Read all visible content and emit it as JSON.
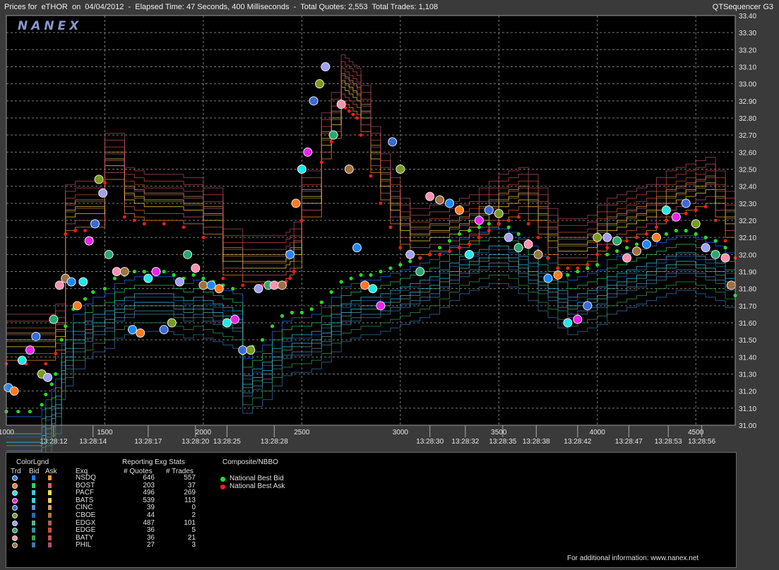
{
  "header": {
    "title": "Prices for  eTHOR  on  04/04/2012  -  Elapsed Time: 47 Seconds, 400 Milliseconds  -  Total Quotes: 2,553  Total Trades: 1,108",
    "brand": "QTSequencer G3",
    "watermark": "NANEX"
  },
  "colors": {
    "background": "#000000",
    "national_best_bid": "#22dd22",
    "national_best_ask": "#ff1a1a"
  },
  "chart_data": {
    "type": "line",
    "title": "",
    "xlabel": "",
    "ylabel": "",
    "grid": true,
    "ylim": [
      31.0,
      33.4
    ],
    "xlim": [
      1000,
      4700
    ],
    "y_ticks": [
      "31.00",
      "31.10",
      "31.20",
      "31.30",
      "31.40",
      "31.50",
      "31.60",
      "31.70",
      "31.80",
      "31.90",
      "32.00",
      "32.10",
      "32.20",
      "32.30",
      "32.40",
      "32.50",
      "32.60",
      "32.70",
      "32.80",
      "32.90",
      "33.00",
      "33.10",
      "33.20",
      "33.30",
      "33.40"
    ],
    "x_sequence_ticks": [
      {
        "value": 1000,
        "label": "1000"
      },
      {
        "value": 1500,
        "label": "1500"
      },
      {
        "value": 2000,
        "label": "2000"
      },
      {
        "value": 2500,
        "label": "2500"
      },
      {
        "value": 3000,
        "label": "3000"
      },
      {
        "value": 3500,
        "label": "3500"
      },
      {
        "value": 4000,
        "label": "4000"
      },
      {
        "value": 4500,
        "label": "4500"
      }
    ],
    "x_time_ticks": [
      {
        "value": 1240,
        "label": "13:28:12"
      },
      {
        "value": 1440,
        "label": "13:28:14"
      },
      {
        "value": 1720,
        "label": "13:28:17"
      },
      {
        "value": 1960,
        "label": "13:28:20"
      },
      {
        "value": 2120,
        "label": "13:28:25"
      },
      {
        "value": 2360,
        "label": "13:28:28"
      },
      {
        "value": 3150,
        "label": "13:28:30"
      },
      {
        "value": 3330,
        "label": "13:28:32"
      },
      {
        "value": 3520,
        "label": "13:28:35"
      },
      {
        "value": 3690,
        "label": "13:28:38"
      },
      {
        "value": 3900,
        "label": "13:28:42"
      },
      {
        "value": 4160,
        "label": "13:28:47"
      },
      {
        "value": 4360,
        "label": "13:28:53"
      },
      {
        "value": 4530,
        "label": "13:28:56"
      }
    ],
    "series": [
      {
        "name": "National Best Bid",
        "role": "nbbo_bid",
        "x": [
          1000,
          1060,
          1120,
          1180,
          1200,
          1230,
          1250,
          1280,
          1300,
          1340,
          1400,
          1440,
          1500,
          1550,
          1600,
          1650,
          1700,
          1750,
          1800,
          1850,
          1900,
          1950,
          2000,
          2050,
          2100,
          2150,
          2200,
          2250,
          2300,
          2350,
          2400,
          2450,
          2500,
          2550,
          2600,
          2650,
          2700,
          2750,
          2800,
          2850,
          2900,
          2950,
          3000,
          3050,
          3100,
          3150,
          3200,
          3250,
          3300,
          3350,
          3400,
          3450,
          3500,
          3550,
          3600,
          3650,
          3700,
          3750,
          3800,
          3850,
          3900,
          3950,
          4000,
          4050,
          4100,
          4150,
          4200,
          4250,
          4300,
          4350,
          4400,
          4450,
          4500,
          4550,
          4600,
          4650,
          4700
        ],
        "y": [
          31.08,
          31.08,
          31.08,
          31.12,
          31.18,
          31.24,
          31.3,
          31.5,
          31.58,
          31.68,
          31.74,
          31.78,
          31.8,
          31.86,
          31.88,
          31.9,
          31.9,
          31.9,
          31.9,
          31.88,
          31.86,
          31.88,
          31.86,
          31.84,
          31.82,
          31.8,
          31.42,
          31.46,
          31.5,
          31.58,
          31.64,
          31.66,
          31.66,
          31.68,
          31.72,
          31.78,
          31.84,
          31.86,
          31.88,
          31.88,
          31.9,
          31.92,
          31.94,
          31.96,
          31.98,
          32.0,
          32.04,
          32.08,
          32.12,
          32.14,
          32.16,
          32.18,
          32.18,
          32.16,
          32.12,
          32.08,
          32.02,
          31.98,
          31.92,
          31.88,
          31.9,
          31.92,
          31.94,
          32.0,
          32.02,
          32.04,
          32.06,
          32.08,
          32.1,
          32.12,
          32.14,
          32.14,
          32.12,
          32.1,
          32.08,
          32.04,
          31.76
        ]
      },
      {
        "name": "National Best Ask",
        "role": "nbbo_ask",
        "x": [
          1000,
          1100,
          1200,
          1250,
          1300,
          1350,
          1400,
          1500,
          1600,
          1650,
          1700,
          1800,
          1900,
          2000,
          2100,
          2200,
          2300,
          2400,
          2420,
          2440,
          2460,
          2500,
          2600,
          2650,
          2700,
          2720,
          2740,
          2760,
          2780,
          2800,
          2850,
          2900,
          2950,
          3000,
          3050,
          3100,
          3150,
          3200,
          3250,
          3300,
          3350,
          3400,
          3450,
          3500,
          3550,
          3600,
          3650,
          3700,
          3750,
          3800,
          3850,
          3900,
          3950,
          4000,
          4050,
          4100,
          4150,
          4200,
          4250,
          4300,
          4350,
          4400,
          4450,
          4500,
          4550,
          4600,
          4650,
          4700
        ],
        "y": [
          31.36,
          31.36,
          31.36,
          31.42,
          32.12,
          32.14,
          32.14,
          32.42,
          32.22,
          32.2,
          32.18,
          32.18,
          32.16,
          32.1,
          31.86,
          31.82,
          31.82,
          31.82,
          31.84,
          31.86,
          31.9,
          32.2,
          32.54,
          32.66,
          32.88,
          32.86,
          32.84,
          32.82,
          32.8,
          32.7,
          32.46,
          32.3,
          32.16,
          32.04,
          31.98,
          31.98,
          32.0,
          32.0,
          32.02,
          32.04,
          32.06,
          32.1,
          32.14,
          32.18,
          32.2,
          32.22,
          32.18,
          32.1,
          31.98,
          31.92,
          31.92,
          31.92,
          31.94,
          32.0,
          32.04,
          32.06,
          32.08,
          32.1,
          32.12,
          32.16,
          32.2,
          32.22,
          32.24,
          32.26,
          32.28,
          32.2,
          32.08,
          31.98
        ]
      }
    ],
    "trades_sample": [
      {
        "x": 1010,
        "y": 31.22
      },
      {
        "x": 1040,
        "y": 31.2
      },
      {
        "x": 1080,
        "y": 31.38
      },
      {
        "x": 1120,
        "y": 31.44
      },
      {
        "x": 1150,
        "y": 31.52
      },
      {
        "x": 1180,
        "y": 31.3
      },
      {
        "x": 1210,
        "y": 31.28
      },
      {
        "x": 1240,
        "y": 31.62
      },
      {
        "x": 1270,
        "y": 31.82
      },
      {
        "x": 1300,
        "y": 31.86
      },
      {
        "x": 1330,
        "y": 31.84
      },
      {
        "x": 1360,
        "y": 31.7
      },
      {
        "x": 1390,
        "y": 31.84
      },
      {
        "x": 1420,
        "y": 32.08
      },
      {
        "x": 1450,
        "y": 32.18
      },
      {
        "x": 1470,
        "y": 32.44
      },
      {
        "x": 1490,
        "y": 32.36
      },
      {
        "x": 1520,
        "y": 32.0
      },
      {
        "x": 1560,
        "y": 31.9
      },
      {
        "x": 1600,
        "y": 31.9
      },
      {
        "x": 1640,
        "y": 31.56
      },
      {
        "x": 1680,
        "y": 31.54
      },
      {
        "x": 1720,
        "y": 31.86
      },
      {
        "x": 1760,
        "y": 31.9
      },
      {
        "x": 1800,
        "y": 31.56
      },
      {
        "x": 1840,
        "y": 31.6
      },
      {
        "x": 1880,
        "y": 31.84
      },
      {
        "x": 1920,
        "y": 32.0
      },
      {
        "x": 1960,
        "y": 31.92
      },
      {
        "x": 2000,
        "y": 31.82
      },
      {
        "x": 2040,
        "y": 31.82
      },
      {
        "x": 2080,
        "y": 31.8
      },
      {
        "x": 2120,
        "y": 31.6
      },
      {
        "x": 2160,
        "y": 31.62
      },
      {
        "x": 2200,
        "y": 31.44
      },
      {
        "x": 2240,
        "y": 31.44
      },
      {
        "x": 2280,
        "y": 31.8
      },
      {
        "x": 2330,
        "y": 31.82
      },
      {
        "x": 2360,
        "y": 31.82
      },
      {
        "x": 2400,
        "y": 31.82
      },
      {
        "x": 2440,
        "y": 32.0
      },
      {
        "x": 2470,
        "y": 32.3
      },
      {
        "x": 2500,
        "y": 32.5
      },
      {
        "x": 2530,
        "y": 32.6
      },
      {
        "x": 2560,
        "y": 32.9
      },
      {
        "x": 2590,
        "y": 33.0
      },
      {
        "x": 2620,
        "y": 33.1
      },
      {
        "x": 2660,
        "y": 32.7
      },
      {
        "x": 2700,
        "y": 32.88
      },
      {
        "x": 2740,
        "y": 32.5
      },
      {
        "x": 2780,
        "y": 32.04
      },
      {
        "x": 2820,
        "y": 31.82
      },
      {
        "x": 2860,
        "y": 31.8
      },
      {
        "x": 2900,
        "y": 31.7
      },
      {
        "x": 2960,
        "y": 32.66
      },
      {
        "x": 3000,
        "y": 32.5
      },
      {
        "x": 3050,
        "y": 32.0
      },
      {
        "x": 3100,
        "y": 31.9
      },
      {
        "x": 3150,
        "y": 32.34
      },
      {
        "x": 3200,
        "y": 32.32
      },
      {
        "x": 3250,
        "y": 32.3
      },
      {
        "x": 3300,
        "y": 32.26
      },
      {
        "x": 3350,
        "y": 32.0
      },
      {
        "x": 3400,
        "y": 32.2
      },
      {
        "x": 3450,
        "y": 32.26
      },
      {
        "x": 3500,
        "y": 32.24
      },
      {
        "x": 3550,
        "y": 32.1
      },
      {
        "x": 3600,
        "y": 32.04
      },
      {
        "x": 3650,
        "y": 32.06
      },
      {
        "x": 3700,
        "y": 32.0
      },
      {
        "x": 3750,
        "y": 31.86
      },
      {
        "x": 3800,
        "y": 31.88
      },
      {
        "x": 3850,
        "y": 31.6
      },
      {
        "x": 3900,
        "y": 31.62
      },
      {
        "x": 3950,
        "y": 31.7
      },
      {
        "x": 4000,
        "y": 32.1
      },
      {
        "x": 4050,
        "y": 32.1
      },
      {
        "x": 4100,
        "y": 32.08
      },
      {
        "x": 4150,
        "y": 31.98
      },
      {
        "x": 4200,
        "y": 32.02
      },
      {
        "x": 4250,
        "y": 32.06
      },
      {
        "x": 4300,
        "y": 32.1
      },
      {
        "x": 4350,
        "y": 32.26
      },
      {
        "x": 4400,
        "y": 32.22
      },
      {
        "x": 4450,
        "y": 32.3
      },
      {
        "x": 4500,
        "y": 32.18
      },
      {
        "x": 4550,
        "y": 32.04
      },
      {
        "x": 4600,
        "y": 32.0
      },
      {
        "x": 4650,
        "y": 31.98
      },
      {
        "x": 4680,
        "y": 31.82
      }
    ]
  },
  "legend": {
    "color_legend_title": "ColorLgnd",
    "col_trd": "Trd",
    "col_bid": "Bid",
    "col_ask": "Ask",
    "col_exq": "Exq",
    "stats_title": "Reporting Exg Stats",
    "col_quotes": "# Quotes",
    "col_trades": "# Trades",
    "nbbo_title": "Composite/NBBO",
    "nbbo_bid_label": "National Best Bid",
    "nbbo_ask_label": "National Best Ask",
    "footer": "For additional information: www.nanex.net",
    "exchanges": [
      {
        "code": "NSDQ",
        "quotes": "646",
        "trades": "557",
        "trd_color": "#1e88ff",
        "bid_color": "#1e78ff",
        "ask_color": "#ff9a2a"
      },
      {
        "code": "BOST",
        "quotes": "203",
        "trades": "37",
        "trd_color": "#ff7a20",
        "bid_color": "#2ad070",
        "ask_color": "#d46070"
      },
      {
        "code": "PACF",
        "quotes": "496",
        "trades": "269",
        "trd_color": "#20e8e8",
        "bid_color": "#40c8e0",
        "ask_color": "#ffe040"
      },
      {
        "code": "BATS",
        "quotes": "539",
        "trades": "113",
        "trd_color": "#ee22ee",
        "bid_color": "#3ad0ff",
        "ask_color": "#f0d060"
      },
      {
        "code": "CINC",
        "quotes": "39",
        "trades": "0",
        "trd_color": "#3a6ad8",
        "bid_color": "#6090d0",
        "ask_color": "#d4a060"
      },
      {
        "code": "CBOE",
        "quotes": "44",
        "trades": "2",
        "trd_color": "#7a9a20",
        "bid_color": "#2a6ab0",
        "ask_color": "#b07a30"
      },
      {
        "code": "EDGX",
        "quotes": "487",
        "trades": "101",
        "trd_color": "#a0a0f0",
        "bid_color": "#60b090",
        "ask_color": "#b06060"
      },
      {
        "code": "EDGE",
        "quotes": "36",
        "trades": "5",
        "trd_color": "#2aa870",
        "bid_color": "#3a8aa0",
        "ask_color": "#d05030"
      },
      {
        "code": "BATY",
        "quotes": "36",
        "trades": "21",
        "trd_color": "#ff90b0",
        "bid_color": "#3aa050",
        "ask_color": "#d05050"
      },
      {
        "code": "PHIL",
        "quotes": "27",
        "trades": "3",
        "trd_color": "#a07040",
        "bid_color": "#3a7ab0",
        "ask_color": "#b05070"
      }
    ]
  }
}
